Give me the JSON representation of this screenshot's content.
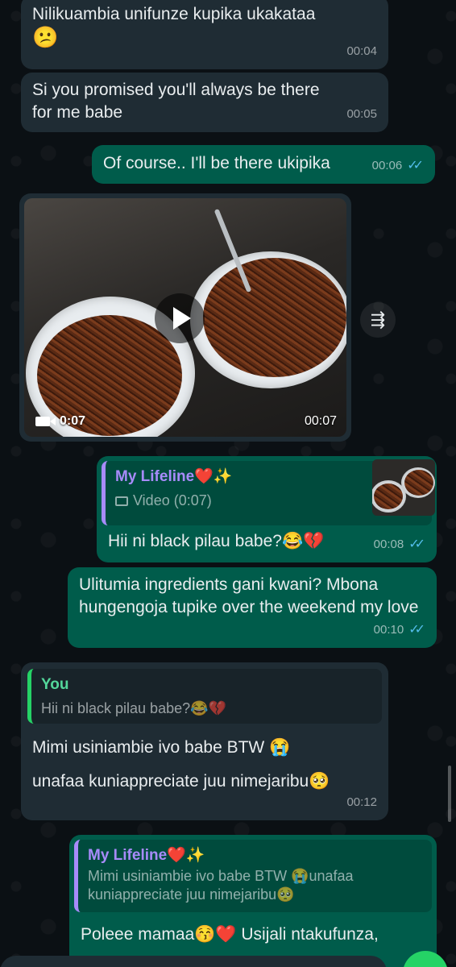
{
  "messages": {
    "m1": {
      "text": "Nilikuambia unifunze kupika ukakataa",
      "emoji": "😕",
      "time": "00:04"
    },
    "m2": {
      "text": "Si you promised you'll always be there for me babe",
      "time": "00:05"
    },
    "m3": {
      "text": "Of course.. I'll be there ukipika",
      "time": "00:06"
    },
    "video": {
      "duration": "0:07",
      "time": "00:07"
    },
    "m4": {
      "quote_author": "My Lifeline❤️✨",
      "quote_text": "Video (0:07)",
      "text": "Hii ni black pilau babe?😂💔",
      "time": "00:08"
    },
    "m5": {
      "text": "Ulitumia ingredients gani kwani? Mbona hungengoja tupike over the weekend my love",
      "time": "00:10"
    },
    "m6": {
      "quote_author": "You",
      "quote_text": "Hii ni black pilau babe?😂💔",
      "line1": "Mimi usiniambie ivo babe BTW 😭",
      "line2": "unafaa kuniappreciate juu nimejaribu🥺",
      "time": "00:12"
    },
    "m7": {
      "quote_author": "My Lifeline❤️✨",
      "quote_text": "Mimi usiniambie ivo babe BTW 😭unafaa kuniappreciate juu nimejaribu🥺",
      "text": "Poleee mamaa😚❤️ Usijali ntakufunza,"
    }
  },
  "icons": {
    "read_receipt": "double-check-icon",
    "forward": "forward-icon",
    "play": "play-icon",
    "video_camera": "video-camera-icon"
  },
  "colors": {
    "incoming_bubble": "#1f2c34",
    "outgoing_bubble": "#005c4b",
    "read_tick": "#53bdeb",
    "quote_bar_purple": "#a78bfa",
    "quote_bar_green": "#25d366"
  }
}
